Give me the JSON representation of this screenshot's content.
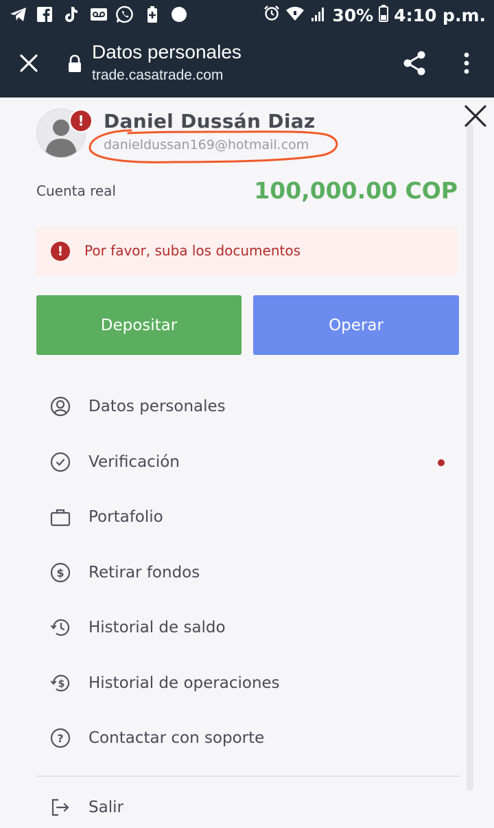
{
  "status_bar": {
    "battery": "30%",
    "time": "4:10 p.m."
  },
  "toolbar": {
    "title": "Datos personales",
    "url": "trade.casatrade.com"
  },
  "profile": {
    "name": "Daniel Dussán Diaz",
    "email": "danieldussan169@hotmail.com",
    "account_label": "Cuenta real",
    "balance": "100,000.00 COP",
    "badge": "!"
  },
  "alert": {
    "icon": "!",
    "text": "Por favor, suba los documentos"
  },
  "buttons": {
    "deposit": "Depositar",
    "trade": "Operar"
  },
  "menu": {
    "items": [
      {
        "label": "Datos personales",
        "icon": "user-circle-icon"
      },
      {
        "label": "Verificación",
        "icon": "check-circle-icon"
      },
      {
        "label": "Portafolio",
        "icon": "briefcase-icon"
      },
      {
        "label": "Retirar fondos",
        "icon": "dollar-circle-icon"
      },
      {
        "label": "Historial de saldo",
        "icon": "history-icon"
      },
      {
        "label": "Historial de operaciones",
        "icon": "dollar-history-icon"
      },
      {
        "label": "Contactar con soporte",
        "icon": "question-circle-icon"
      }
    ],
    "logout": "Salir"
  },
  "colors": {
    "bar": "#1f2b39",
    "green": "#5aae5e",
    "blue": "#6b8bef",
    "alert_red": "#b52a2a",
    "scribble": "#f05a28"
  }
}
